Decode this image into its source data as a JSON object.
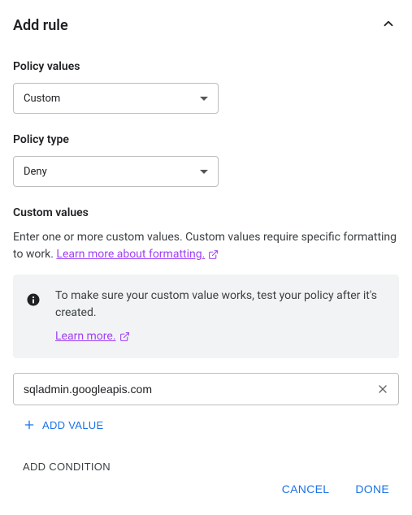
{
  "header": {
    "title": "Add rule"
  },
  "policy_values": {
    "label": "Policy values",
    "selected": "Custom"
  },
  "policy_type": {
    "label": "Policy type",
    "selected": "Deny"
  },
  "custom_values": {
    "label": "Custom values",
    "description_pre": "Enter one or more custom values. Custom values require specific formatting to work. ",
    "learn_more": "Learn more about formatting."
  },
  "callout": {
    "message": "To make sure your custom value works, test your policy after it's created.",
    "learn_more": "Learn more."
  },
  "custom_input": {
    "value": "sqladmin.googleapis.com"
  },
  "buttons": {
    "add_value": "ADD VALUE",
    "add_condition": "ADD CONDITION",
    "cancel": "CANCEL",
    "done": "DONE"
  }
}
